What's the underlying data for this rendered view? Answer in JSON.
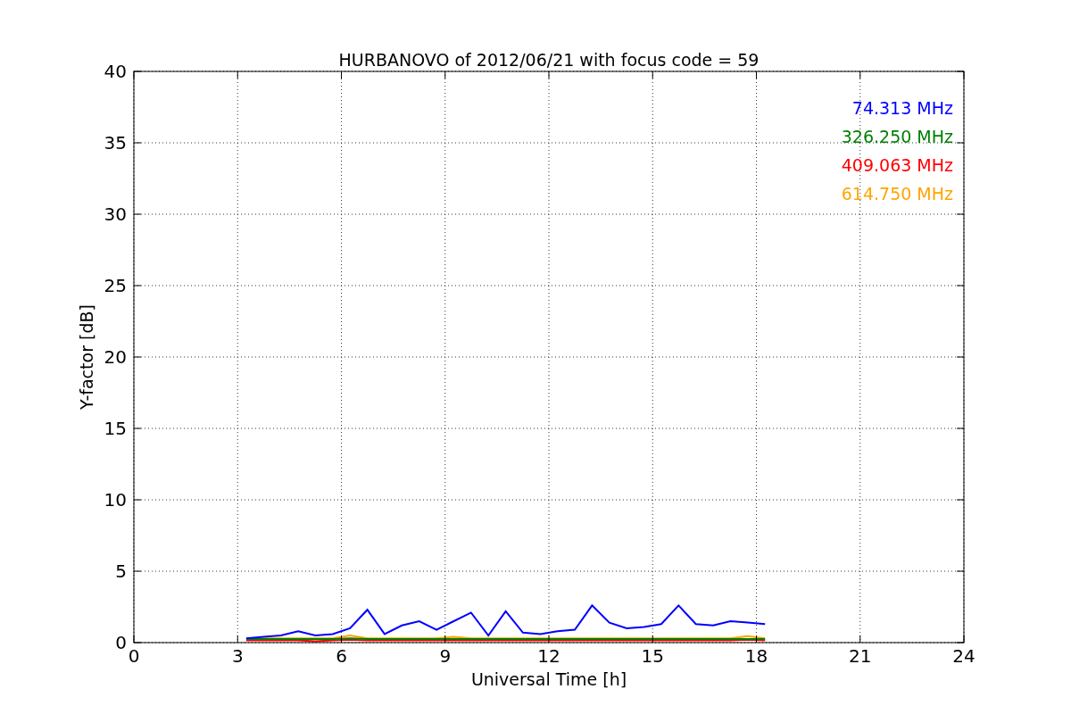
{
  "chart_data": {
    "type": "line",
    "grid": true,
    "title": "HURBANOVO of 2012/06/21 with focus code = 59",
    "xlabel": "Universal Time [h]",
    "ylabel": "Y-factor [dB]",
    "xlim": [
      0,
      24
    ],
    "ylim": [
      0,
      40
    ],
    "xticks": [
      0,
      3,
      6,
      9,
      12,
      15,
      18,
      21,
      24
    ],
    "yticks": [
      0,
      5,
      10,
      15,
      20,
      25,
      30,
      35,
      40
    ],
    "x": [
      3.25,
      3.75,
      4.25,
      4.75,
      5.25,
      5.75,
      6.25,
      6.75,
      7.25,
      7.75,
      8.25,
      8.75,
      9.25,
      9.75,
      10.25,
      10.75,
      11.25,
      11.75,
      12.25,
      12.75,
      13.25,
      13.75,
      14.25,
      14.75,
      15.25,
      15.75,
      16.25,
      16.75,
      17.25,
      17.75,
      18.25
    ],
    "series": [
      {
        "name": "74.313 MHz",
        "color": "#0000ff",
        "values": [
          0.3,
          0.4,
          0.5,
          0.8,
          0.5,
          0.6,
          1.0,
          2.3,
          0.6,
          1.2,
          1.5,
          0.9,
          1.5,
          2.1,
          0.5,
          2.2,
          0.7,
          0.6,
          0.8,
          0.9,
          2.6,
          1.4,
          1.0,
          1.1,
          1.3,
          2.6,
          1.3,
          1.2,
          1.5,
          1.4,
          1.3
        ]
      },
      {
        "name": "326.250 MHz",
        "color": "#008000",
        "values": [
          0.25,
          0.25,
          0.25,
          0.25,
          0.25,
          0.25,
          0.3,
          0.25,
          0.25,
          0.25,
          0.25,
          0.25,
          0.25,
          0.25,
          0.25,
          0.25,
          0.25,
          0.25,
          0.25,
          0.25,
          0.25,
          0.25,
          0.25,
          0.25,
          0.25,
          0.25,
          0.25,
          0.25,
          0.25,
          0.25,
          0.25
        ]
      },
      {
        "name": "409.063 MHz",
        "color": "#ff0000",
        "values": [
          0.15,
          0.15,
          0.15,
          0.15,
          0.1,
          0.15,
          0.2,
          0.15,
          0.15,
          0.15,
          0.15,
          0.15,
          0.15,
          0.15,
          0.15,
          0.15,
          0.15,
          0.15,
          0.15,
          0.15,
          0.15,
          0.15,
          0.15,
          0.15,
          0.15,
          0.15,
          0.15,
          0.15,
          0.15,
          0.2,
          0.15
        ]
      },
      {
        "name": "614.750 MHz",
        "color": "#ffa500",
        "values": [
          0.3,
          0.3,
          0.3,
          0.3,
          0.3,
          0.3,
          0.5,
          0.3,
          0.3,
          0.3,
          0.3,
          0.3,
          0.4,
          0.3,
          0.3,
          0.3,
          0.3,
          0.3,
          0.3,
          0.3,
          0.3,
          0.3,
          0.3,
          0.3,
          0.3,
          0.3,
          0.3,
          0.3,
          0.3,
          0.45,
          0.3
        ]
      }
    ]
  }
}
